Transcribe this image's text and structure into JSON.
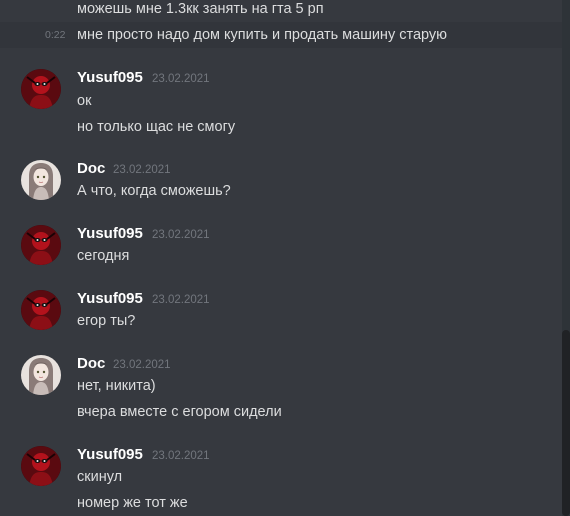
{
  "continuation": {
    "line1": "можешь мне 1.3кк занять на гта 5 рп",
    "line2_time": "0:22",
    "line2": "мне просто надо дом купить и продать машину старую"
  },
  "messages": [
    {
      "author": "Yusuf095",
      "date": "23.02.2021",
      "avatar_icon": "deadpool-avatar-icon",
      "lines": [
        "ок",
        "но только щас не смогу"
      ]
    },
    {
      "author": "Doc",
      "date": "23.02.2021",
      "avatar_icon": "anime-girl-avatar-icon",
      "lines": [
        "А что, когда сможешь?"
      ]
    },
    {
      "author": "Yusuf095",
      "date": "23.02.2021",
      "avatar_icon": "deadpool-avatar-icon",
      "lines": [
        "сегодня"
      ]
    },
    {
      "author": "Yusuf095",
      "date": "23.02.2021",
      "avatar_icon": "deadpool-avatar-icon",
      "lines": [
        "егор ты?"
      ]
    },
    {
      "author": "Doc",
      "date": "23.02.2021",
      "avatar_icon": "anime-girl-avatar-icon",
      "lines": [
        "нет, никита)",
        "вчера вместе с егором сидели"
      ]
    },
    {
      "author": "Yusuf095",
      "date": "23.02.2021",
      "avatar_icon": "deadpool-avatar-icon",
      "lines": [
        "скинул",
        "номер же тот же"
      ]
    }
  ],
  "colors": {
    "background": "#36393f",
    "text": "#dcddde",
    "username": "#ffffff",
    "timestamp": "#72767d"
  }
}
